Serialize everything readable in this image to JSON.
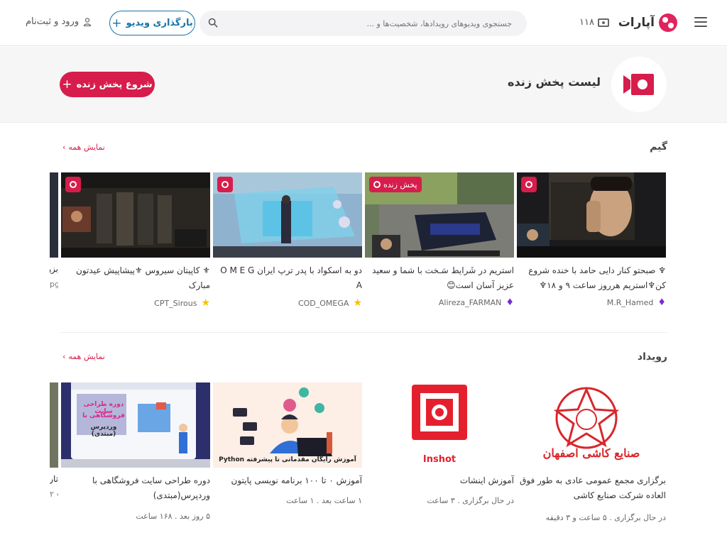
{
  "header": {
    "logo_text": "آپارات",
    "live_count": "۱۱۸",
    "search_placeholder": "جستجوی ویدیوهای رویدادها، شخصیت‌ها و ...",
    "upload_label": "بارگذاری ویدیو",
    "login_label": "ورود و ثبت‌نام"
  },
  "banner": {
    "title": "لیست پخش زنده",
    "start_live_label": "شروع پخش زنده"
  },
  "sections": {
    "game": {
      "title": "گیم",
      "show_all": "نمایش همه",
      "cards": [
        {
          "title": "♆ صبحتو کنار دایی حامد با خنده شروع کن♆استریم هرروز ساعت ۹ و ۱۸♆",
          "author": "M.R_Hamed",
          "badge": "diamond",
          "live_tag": ""
        },
        {
          "title": "استریم در شَرایط سَـخت با شما و سعید عزیز آسان است😊",
          "author": "Alireza_FARMAN",
          "badge": "diamond",
          "live_tag": "پخش زنده"
        },
        {
          "title": "دو به اسکواد با پدر ترپ ایران O M E G A",
          "author": "COD_OMEGA",
          "badge": "star",
          "live_tag": ""
        },
        {
          "title": "⚜ کاپیتان سیروس ⚜پیشاپیش عیدتون مبارک",
          "author": "CPT_Sirous",
          "badge": "star",
          "live_tag": ""
        }
      ],
      "partial_title": "بزر",
      "partial_meta": "pg"
    },
    "event": {
      "title": "رویداد",
      "show_all": "نمایش همه",
      "cards": [
        {
          "title": "برگزاری مجمع عمومی عادی به طور فوق العاده شرکت صنایع کاشی",
          "meta": "در حال برگزاری . ۵ ساعت و ۳ دقیقه"
        },
        {
          "title": "آموزش اینشات",
          "meta": "در حال برگزاری . ۳ ساعت"
        },
        {
          "title": "آموزش ۰ تا ۱۰۰ برنامه نویسی پایتون",
          "meta": "۱ ساعت بعد . ۱ ساعت"
        },
        {
          "title": "دوره طراحی سایت فروشگاهی با وردپرس(مبتدی)",
          "meta": "۵ روز بعد . ۱۶۸ ساعت"
        }
      ],
      "thumb_texts": {
        "kashi": "صنایع کاشی اصفهان",
        "inshot": "Inshot",
        "python": "آموزش رایگان مقدماتی تا پیشرفته Python",
        "wordpress_1": "دوره طراحی سایت",
        "wordpress_2": "فروشگاهی با",
        "wordpress_3": "وردپرس (مبتدی)"
      },
      "partial_title": "تار",
      "partial_meta": "۲ ‹"
    }
  },
  "colors": {
    "brand": "#d61d4c",
    "upload_blue": "#1a73a8"
  }
}
